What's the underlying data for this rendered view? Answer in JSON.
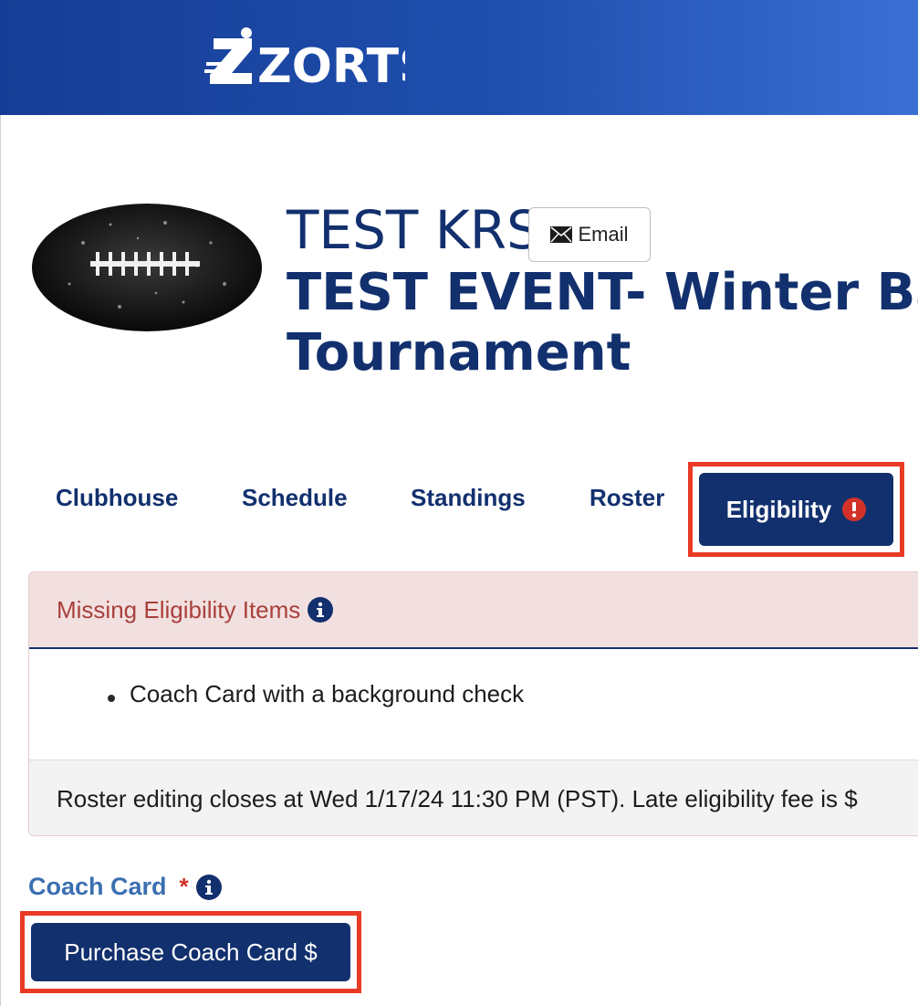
{
  "brand": {
    "logo_text": "ZORTS"
  },
  "team": {
    "name": "TEST KRS",
    "email_button_label": "Email",
    "event_title_line1": "TEST EVENT- Winter Bash",
    "event_title_line2": "Tournament"
  },
  "tabs": [
    {
      "label": "Clubhouse",
      "active": false
    },
    {
      "label": "Schedule",
      "active": false
    },
    {
      "label": "Standings",
      "active": false
    },
    {
      "label": "Roster",
      "active": false
    },
    {
      "label": "Eligibility",
      "active": true,
      "badge_icon": "alert-icon"
    }
  ],
  "eligibility_panel": {
    "title": "Missing Eligibility Items",
    "title_icon": "info-icon",
    "items": [
      "Coach Card with a background check"
    ],
    "notice": "Roster editing closes at Wed 1/17/24 11:30 PM (PST). Late eligibility fee is $"
  },
  "coach_card": {
    "label": "Coach Card",
    "required_marker": "*",
    "label_icon": "info-icon",
    "button_label": "Purchase Coach Card $"
  },
  "colors": {
    "brand_navy": "#12306e",
    "header_blue": "#1f4fae",
    "highlight_red": "#ea3a26",
    "alert_red": "#d3322a",
    "panel_title_red": "#a8403c",
    "label_blue": "#3a6fb0"
  }
}
